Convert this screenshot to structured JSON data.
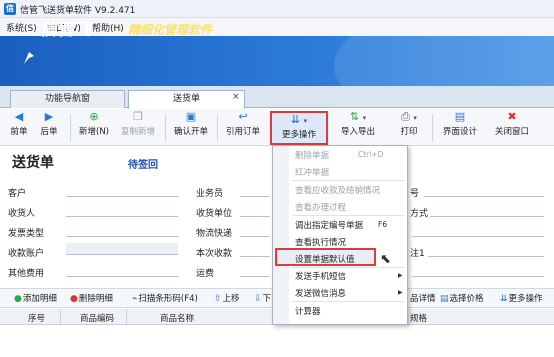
{
  "window": {
    "title": "信管飞送货单软件 V9.2.471",
    "icon": "信"
  },
  "menubar": [
    {
      "label": "系统(S)"
    },
    {
      "label": "窗口(W)"
    },
    {
      "label": "帮助(H)"
    }
  ],
  "banner": {
    "logo": "信管飞",
    "dot": "·",
    "slogan": "精细化管理软件"
  },
  "tabs": [
    {
      "label": "功能导航窗"
    },
    {
      "label": "送货单"
    }
  ],
  "tab_close_glyph": "×",
  "toolbar": {
    "prev": {
      "label": "前单",
      "icon": "◀"
    },
    "next": {
      "label": "后单",
      "icon": "▶"
    },
    "add": {
      "label": "新增(N)",
      "icon": "⊕"
    },
    "copy_add": {
      "label": "复制新增",
      "icon": "❐"
    },
    "confirm": {
      "label": "确认开单",
      "icon": "▣"
    },
    "ref_order": {
      "label": "引用订单",
      "icon": "↩"
    },
    "more_ops": {
      "label": "更多操作",
      "icon": "⇊"
    },
    "import_export": {
      "label": "导入导出",
      "icon": "⇅"
    },
    "print": {
      "label": "打印",
      "icon": "⎙"
    },
    "ui_design": {
      "label": "界面设计",
      "icon": "▤"
    },
    "close_window": {
      "label": "关闭窗口",
      "icon": "✖"
    },
    "dropdown_arrow": "▾"
  },
  "form": {
    "title": "送货单",
    "status": "待签回",
    "left_labels": [
      "客户",
      "收货人",
      "发票类型",
      "收款账户",
      "其他费用"
    ],
    "mid_labels": [
      "业务员",
      "收货单位",
      "物流快递",
      "本次收款",
      "运费"
    ],
    "right_labels": [
      "号",
      "方式",
      "",
      "注1",
      ""
    ]
  },
  "detail_toolbar": {
    "add_row": "添加明细",
    "delete_row": "删除明细",
    "scan": "扫描条形码(F4)",
    "move_up": "上移",
    "move_down": "下",
    "product_detail": "品详情",
    "select_price": "选择价格",
    "more_ops": "更多操作"
  },
  "grid": {
    "columns": [
      "序号",
      "商品编码",
      "商品名称",
      "规格"
    ]
  },
  "dropdown": {
    "items": [
      {
        "label": "删除单据",
        "shortcut": "Ctrl+D",
        "disabled": true
      },
      {
        "label": "红冲单据",
        "disabled": true
      },
      {
        "label": "查看应收款及结销情况",
        "disabled": true
      },
      {
        "label": "查看办理过程",
        "disabled": true
      },
      {
        "label": "调出指定编号单据",
        "shortcut": "F6",
        "disabled": false
      },
      {
        "label": "查看执行情况",
        "disabled": false
      },
      {
        "label": "设置单据默认值",
        "disabled": false
      },
      {
        "label": "发送手机短信",
        "disabled": false,
        "submenu": true
      },
      {
        "label": "发送微信消息",
        "disabled": false,
        "submenu": true
      },
      {
        "label": "计算器",
        "disabled": false
      }
    ],
    "submenu_glyph": "▶",
    "cursor_glyph": "⬉"
  },
  "colors": {
    "banner_blue": "#1a5fc0",
    "highlight_red": "#e03b3b",
    "status_blue": "#1f4fb3",
    "slogan_yellow": "#ffe06b"
  }
}
